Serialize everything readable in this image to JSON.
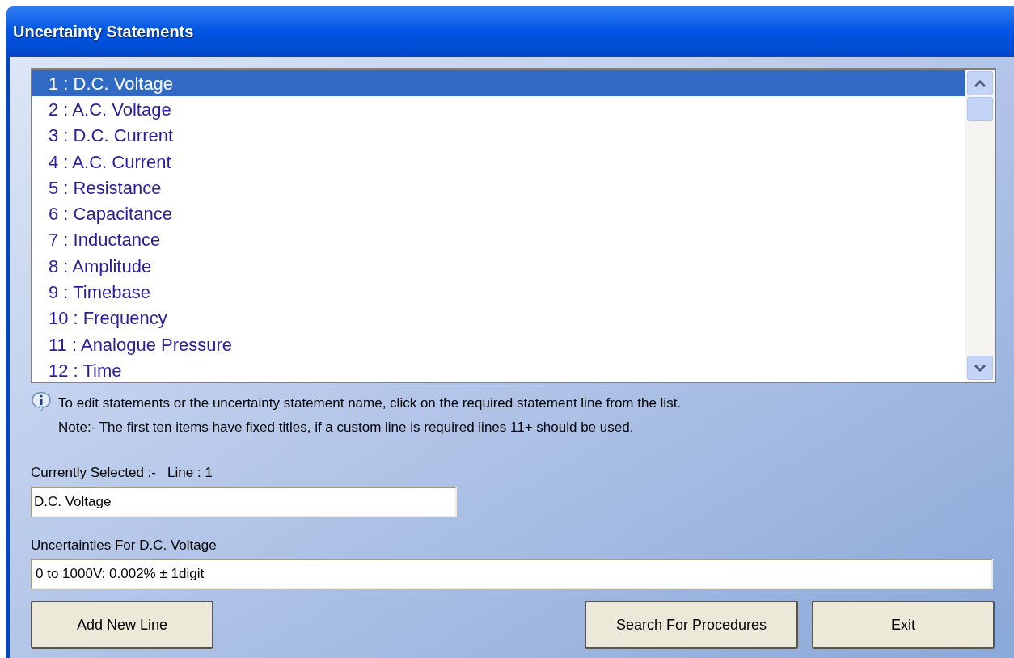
{
  "window": {
    "title": "Uncertainty Statements"
  },
  "statements": [
    {
      "label": "1 : D.C. Voltage",
      "selected": true
    },
    {
      "label": "2 : A.C. Voltage",
      "selected": false
    },
    {
      "label": "3 : D.C. Current",
      "selected": false
    },
    {
      "label": "4 : A.C. Current",
      "selected": false
    },
    {
      "label": "5 : Resistance",
      "selected": false
    },
    {
      "label": "6 : Capacitance",
      "selected": false
    },
    {
      "label": "7 : Inductance",
      "selected": false
    },
    {
      "label": "8 : Amplitude",
      "selected": false
    },
    {
      "label": "9 : Timebase",
      "selected": false
    },
    {
      "label": "10 : Frequency",
      "selected": false
    },
    {
      "label": "11 : Analogue Pressure",
      "selected": false
    },
    {
      "label": "12 : Time",
      "selected": false
    }
  ],
  "info": [
    "To edit statements or the uncertainty statement name, click on the required statement line from the list.",
    "Note:- The first ten items have fixed titles, if a custom line is required lines 11+ should be used."
  ],
  "selected_label": "Currently Selected :-   Line : 1",
  "name_field": {
    "value": "D.C. Voltage"
  },
  "uncertainty_label": "Uncertainties For D.C. Voltage",
  "uncertainty_field": {
    "value": "0 to 1000V: 0.002% ± 1digit"
  },
  "buttons": [
    {
      "label": "Add New Line",
      "kind": "left"
    },
    {
      "label": "Search For Procedures",
      "kind": "right"
    },
    {
      "label": "Exit",
      "kind": "right"
    }
  ]
}
